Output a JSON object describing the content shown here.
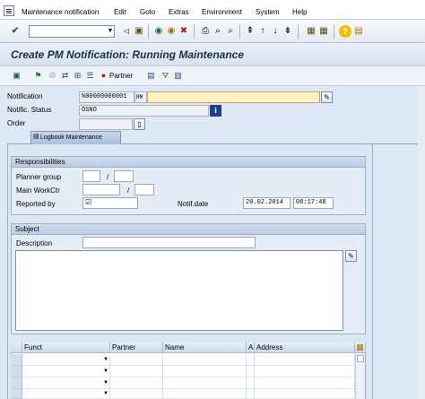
{
  "menu": {
    "items": [
      "Maintenance notification",
      "Edit",
      "Goto",
      "Extras",
      "Environment",
      "System",
      "Help"
    ]
  },
  "toolbar": {
    "okcode_value": "",
    "icons": [
      "enter-icon",
      "back-icon",
      "save-icon",
      "exit-icon",
      "cancel-icon",
      "print-icon",
      "find-icon",
      "find-next-icon",
      "first-page-icon",
      "previous-page-icon",
      "next-page-icon",
      "last-page-icon",
      "new-session-icon",
      "shortcut-icon",
      "help-icon",
      "layout-icon"
    ]
  },
  "title": "Create PM Notification: Running Maintenance",
  "app_toolbar": {
    "partner_label": "Partner"
  },
  "header": {
    "notification_label": "Notification",
    "notification_value": "%00000000001",
    "notification_type": "RM",
    "notification_text": "",
    "status_label": "Notific. Status",
    "status_value": "OSNO",
    "order_label": "Order",
    "order_value": ""
  },
  "tab": {
    "label": "Logbook Maintenance"
  },
  "responsibilities": {
    "title": "Responsibilities",
    "planner_group_label": "Planner group",
    "planner_group_value": "",
    "planner_group_plant": "",
    "separator": "/",
    "main_workctr_label": "Main WorkCtr",
    "main_workctr_value": "",
    "main_workctr_plant": "",
    "reported_by_label": "Reported by",
    "reported_by_value": "",
    "notif_date_label": "Notif.date",
    "notif_date_value": "20.02.2014",
    "notif_time_value": "08:17:48"
  },
  "subject": {
    "title": "Subject",
    "description_label": "Description",
    "description_value": ""
  },
  "table": {
    "columns": [
      "Funct",
      "Partner",
      "Name",
      "A",
      "Address"
    ],
    "rows": [
      [
        "",
        "",
        "",
        "",
        ""
      ],
      [
        "",
        "",
        "",
        "",
        ""
      ],
      [
        "",
        "",
        "",
        "",
        ""
      ],
      [
        "",
        "",
        "",
        "",
        ""
      ]
    ]
  }
}
